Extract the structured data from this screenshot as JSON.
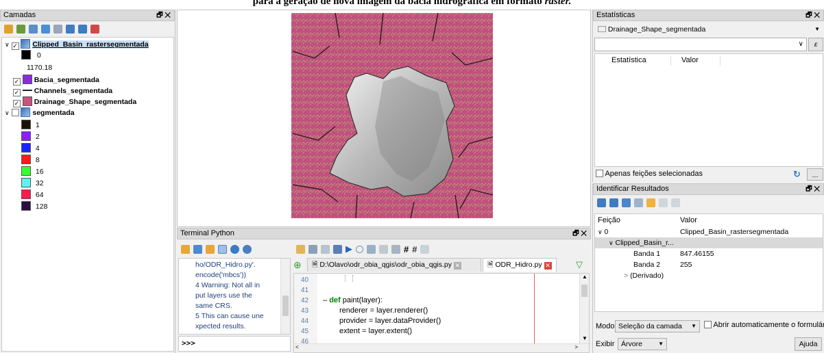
{
  "banner": {
    "text": "para a geração de nova imagem da bacia hidrográfica em formato ",
    "text_italic": "raster."
  },
  "layers_panel": {
    "title": "Camadas",
    "layers": [
      {
        "name": "Clipped_Basin_rastersegmentada",
        "checked": true
      },
      {
        "name": "Bacia_segmentada",
        "checked": true,
        "color": "#8a2be2"
      },
      {
        "name": "Channels_segmentada",
        "checked": true
      },
      {
        "name": "Drainage_Shape_segmentada",
        "checked": true,
        "color": "#c8557d"
      },
      {
        "name": "segmentada",
        "checked": false
      }
    ],
    "gradient": {
      "min": "0",
      "max": "1170.18"
    },
    "classes": [
      {
        "label": "1",
        "color": "#1a1200"
      },
      {
        "label": "2",
        "color": "#8b1fff"
      },
      {
        "label": "4",
        "color": "#1a22ff"
      },
      {
        "label": "8",
        "color": "#ff1a1a"
      },
      {
        "label": "16",
        "color": "#33ff33"
      },
      {
        "label": "32",
        "color": "#5ff2f2"
      },
      {
        "label": "64",
        "color": "#ff1a50"
      },
      {
        "label": "128",
        "color": "#2a1040"
      }
    ]
  },
  "python": {
    "title": "Terminal Python",
    "output_lines": [
      "ho/ODR_Hidro.py'.",
      "encode('mbcs'))",
      "4 Warning: Not all in",
      "put layers use the",
      "same CRS.",
      "5 This can cause une",
      "xpected results."
    ],
    "prompt": ">>>",
    "tabs": [
      {
        "label": "D:\\Olavo\\odr_obia_qgis\\odr_obia_qgis.py"
      },
      {
        "label": "ODR_Hidro.py"
      }
    ],
    "code": [
      {
        "num": "40",
        "text": ""
      },
      {
        "num": "41",
        "text": ""
      },
      {
        "num": "42",
        "kw": "def",
        "text": " paint(layer):"
      },
      {
        "num": "43",
        "text": "renderer = layer.renderer()"
      },
      {
        "num": "44",
        "text": "provider = layer.dataProvider()"
      },
      {
        "num": "45",
        "text": "extent = layer.extent()"
      },
      {
        "num": "46",
        "text": ""
      }
    ]
  },
  "stats": {
    "title": "Estatísticas",
    "layer": "Drainage_Shape_segmentada",
    "col_stat": "Estatística",
    "col_value": "Valor",
    "only_selected": "Apenas feições selecionadas",
    "more": "..."
  },
  "identify": {
    "title": "Identificar Resultados",
    "col_feature": "Feição",
    "col_value": "Valor",
    "rows": [
      {
        "feature": "0",
        "value": "Clipped_Basin_rastersegmentada"
      },
      {
        "feature": "Clipped_Basin_r...",
        "value": ""
      },
      {
        "feature": "Banda 1",
        "value": "847.46155"
      },
      {
        "feature": "Banda 2",
        "value": "255"
      },
      {
        "feature": "(Derivado)",
        "value": ""
      }
    ],
    "mode_label": "Modo",
    "mode_value": "Seleção da camada",
    "auto_open": "Abrir automaticamente o formulário",
    "view_label": "Exibir",
    "view_value": "Árvore",
    "help": "Ajuda"
  }
}
